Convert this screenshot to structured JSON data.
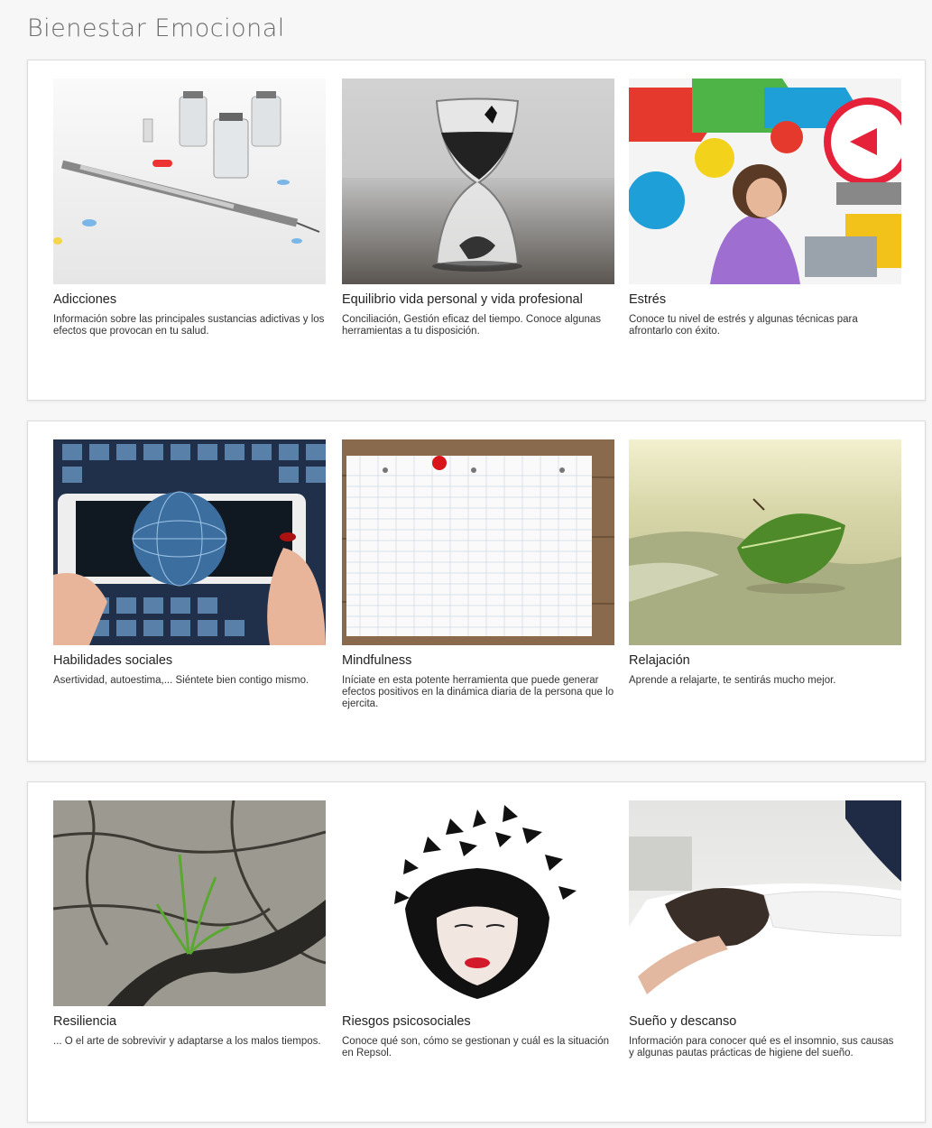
{
  "page": {
    "title": "Bienestar Emocional"
  },
  "sections": [
    {
      "cards": [
        {
          "title": "Adicciones",
          "description": "Información sobre las principales sustancias adictivas y los efectos que provocan en tu salud.",
          "image": "syringe-vials-image"
        },
        {
          "title": "Equilibrio vida personal y vida profesional",
          "description": "Conciliación, Gestión eficaz del tiempo. Conoce algunas herramientas a tu disposición.",
          "image": "hourglass-image"
        },
        {
          "title": "Estrés",
          "description": "Conoce tu nivel de estrés y algunas técnicas para afrontarlo con éxito.",
          "image": "stressed-woman-arrows-image"
        }
      ]
    },
    {
      "cards": [
        {
          "title": "Habilidades sociales",
          "description": "Asertividad, autoestima,... Siéntete bien contigo mismo.",
          "image": "social-globe-phone-image"
        },
        {
          "title": "Mindfulness",
          "description": "Iníciate en esta potente herramienta que puede generar efectos positivos en la dinámica diaria de la persona que lo ejercita.",
          "image": "notepad-pin-image"
        },
        {
          "title": "Relajación",
          "description": "Aprende a relajarte, te sentirás mucho mejor.",
          "image": "leaf-on-beach-image"
        }
      ]
    },
    {
      "cards": [
        {
          "title": "Resiliencia",
          "description": "... O el arte de sobrevivir y adaptarse a los malos tiempos.",
          "image": "sprout-cracked-earth-image"
        },
        {
          "title": "Riesgos psicosociales",
          "description": "Conoce qué son, cómo se gestionan y cuál es la situación en Repsol.",
          "image": "shattered-head-image"
        },
        {
          "title": "Sueño y descanso",
          "description": "Información para conocer qué es el insomnio, sus causas y algunas pautas prácticas de higiene del sueño.",
          "image": "sleeping-woman-image"
        }
      ]
    }
  ]
}
